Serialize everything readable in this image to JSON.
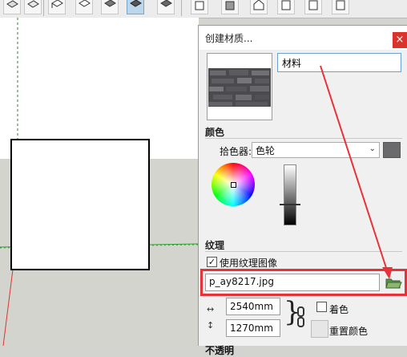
{
  "toolbar": {
    "buttons": [
      {
        "icon": "push-pull-icon"
      },
      {
        "icon": "offset-icon"
      },
      {
        "icon": "iso-view-icon"
      },
      {
        "icon": "top-view-icon"
      },
      {
        "icon": "front-view-icon"
      },
      {
        "icon": "right-view-icon"
      },
      {
        "icon": "back-view-icon"
      },
      {
        "icon": "left-view-icon"
      },
      {
        "icon": "xray-style-icon"
      },
      {
        "icon": "wireframe-style-icon"
      },
      {
        "icon": "hidden-line-style-icon"
      },
      {
        "icon": "shaded-style-icon"
      },
      {
        "icon": "textured-style-icon"
      }
    ],
    "active_index": 6
  },
  "dialog": {
    "title": "创建材质...",
    "close_label": "×",
    "material_name": "材料",
    "color_section_title": "颜色",
    "picker_label": "拾色器:",
    "picker_value": "色轮",
    "swatch_color": "#6b6b6d",
    "texture_section_title": "纹理",
    "use_texture_label": "使用纹理图像",
    "use_texture_checked": true,
    "use_texture_check_mark": "✓",
    "texture_file": "p_ay8217.jpg",
    "width_value": "2540mm",
    "height_value": "1270mm",
    "colorize_label": "着色",
    "reset_color_label": "重置颜色",
    "opacity_label": "不透明"
  },
  "colors": {
    "annotation_red": "#e8323a",
    "dialog_bg": "#f0f0f0",
    "close_red": "#d9342b",
    "ground": "#d4d4cf"
  }
}
